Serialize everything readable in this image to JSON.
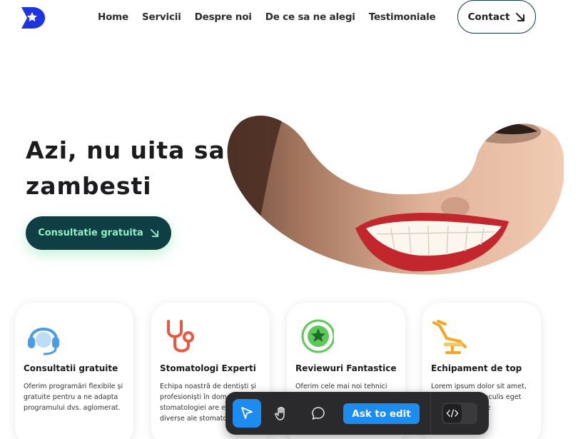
{
  "header": {
    "logo_icon": "star-play-logo",
    "nav": [
      "Home",
      "Servicii",
      "Despre noi",
      "De ce sa ne alegi",
      "Testimoniale"
    ],
    "contact_label": "Contact"
  },
  "hero": {
    "title_line1": "Azi, nu uita sa",
    "title_line2": "zambesti",
    "cta_label": "Consultatie gratuita",
    "image": "smiling-woman-photo"
  },
  "cards": [
    {
      "icon": "headset-icon",
      "title": "Consultatii gratuite",
      "text": "Oferim programări flexibile și gratuite pentru a ne adapta programului dvs. aglomerat."
    },
    {
      "icon": "stethoscope-icon",
      "title": "Stomatologi Experti",
      "text": "Echipa noastră de dentiști și profesioniști în domeniul stomatologiei are experiență în diverse ale stomatologiei."
    },
    {
      "icon": "star-badge-icon",
      "title": "Reviewuri Fantastice",
      "text": "Oferim cele mai noi tehnici"
    },
    {
      "icon": "dental-chair-icon",
      "title": "Echipament de top",
      "text": "Lorem ipsum dolor sit amet, adipiscing elit. iaculis eget pharetra tristique"
    }
  ],
  "toolbar": {
    "ask_label": "Ask to edit",
    "tools": [
      "select-tool",
      "hand-tool",
      "comment-tool",
      "code-toggle"
    ]
  },
  "colors": {
    "primary_dark": "#0f3e44",
    "cta_text": "#8ef0c0",
    "accent_blue": "#1c8cf0",
    "logo_blue": "#1d34e0"
  }
}
